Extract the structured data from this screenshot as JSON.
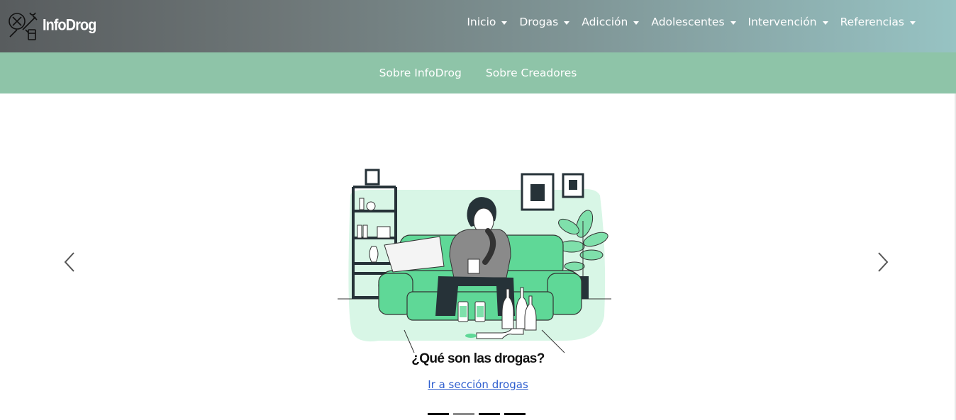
{
  "brand": {
    "name": "InfoDrog",
    "logo_icon": "drugs-logo-icon"
  },
  "nav": {
    "items": [
      {
        "label": "Inicio"
      },
      {
        "label": "Drogas"
      },
      {
        "label": "Adicción"
      },
      {
        "label": "Adolescentes"
      },
      {
        "label": "Intervención"
      },
      {
        "label": "Referencias"
      }
    ]
  },
  "subnav": {
    "items": [
      {
        "label": "Sobre InfoDrog"
      },
      {
        "label": "Sobre Creadores"
      }
    ]
  },
  "carousel": {
    "slide": {
      "title": "¿Qué son las drogas?",
      "link_label": "Ir a sección drogas",
      "image_icon": "sad-man-on-couch-illustration"
    },
    "prev_icon": "chevron-left-icon",
    "next_icon": "chevron-right-icon",
    "indicators": [
      {
        "active": true
      },
      {
        "active": false
      },
      {
        "active": true
      },
      {
        "active": true
      }
    ]
  },
  "colors": {
    "topbar_start": "#585c5e",
    "topbar_end": "#97c3c3",
    "subbar": "#8ec4a8",
    "accent_green": "#5fd897",
    "link": "#2f5fcf"
  }
}
